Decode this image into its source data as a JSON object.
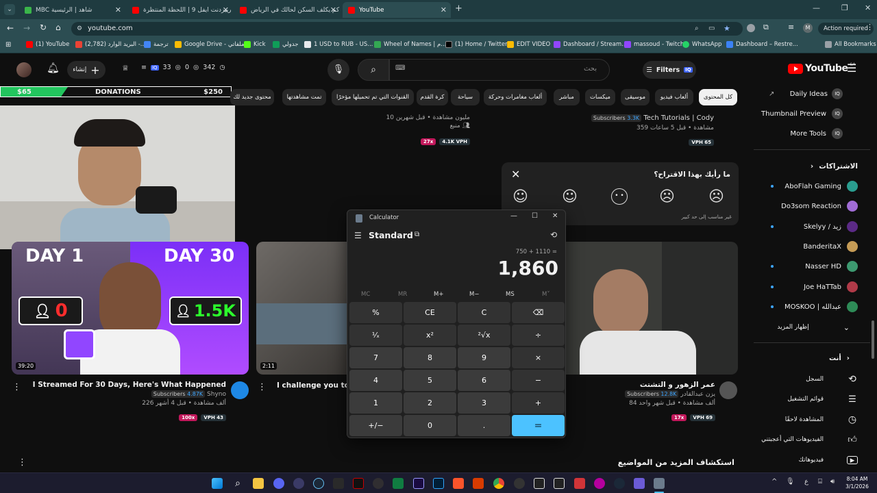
{
  "tabs": [
    {
      "label": "MBC شاهد | الرئيسية",
      "color": "#3ab54a"
    },
    {
      "label": "رييزدنت ايفل 9 | اللحظة المنتظرة",
      "color": "#ff0000"
    },
    {
      "label": "كم يكلف السكن لحالك في الرياض",
      "color": "#ff0000"
    },
    {
      "label": "YouTube",
      "color": "#ff0000"
    }
  ],
  "address": {
    "url": "youtube.com",
    "action_required": "Action required",
    "profile_initial": "M"
  },
  "bookmarks": [
    "(1) YouTube",
    "(2,782) البريد الوارد -...",
    "ترجمة",
    "Google Drive - ملفاتي",
    "Kick",
    "جدولي",
    "1 USD to RUB - US...",
    "Wheel of Names | م...",
    "(1) Home / Twitter",
    "EDIT VIDEO",
    "Dashboard / Stream...",
    "massoud - Twitch",
    "WhatsApp",
    "Dashboard – Restre...",
    "All Bookmarks"
  ],
  "header": {
    "logo": "YouTube",
    "region": "SA",
    "search_placeholder": "بحث",
    "filters": "Filters",
    "create": "إنشاء",
    "stat_a": "342",
    "stat_b": "0",
    "stat_c": "33"
  },
  "donations": {
    "left": "$65",
    "label": "DONATIONS",
    "right": "$250"
  },
  "chips": [
    "كل المحتوى",
    "ألعاب فيديو",
    "موسيقى",
    "ميكسات",
    "مباشر",
    "ألعاب مغامرات وحركة",
    "سياحة",
    "كرة القدم",
    "القنوات التي تم تحميلها مؤخرًا",
    "تمت مشاهدتها",
    "محتوى جديد لك"
  ],
  "sidebar": {
    "tools": [
      "Daily Ideas",
      "Thumbnail Preview",
      "More Tools"
    ],
    "subs_heading": "الاشتراكات",
    "subs": [
      "AboFlah Gaming",
      "Do3som Reaction",
      "Skelyy / زيد",
      "BanderitaX",
      "Nasser HD",
      "Joe HaTTab",
      "MOSKOO | عبدالله"
    ],
    "show_more": "إظهار المزيد",
    "you_heading": "أنت",
    "you": [
      "السجل",
      "قوائم التشغيل",
      "المشاهدة لاحقًا",
      "الفيديوهات التي أعجبتني",
      "فيديوهاتك"
    ]
  },
  "top_videos": [
    {
      "meta1": "10 مليون مشاهدة • قبل شهرين",
      "meta2": "منبع",
      "b1": "27x",
      "b2": "4.1K VPH"
    },
    {
      "channel": "Tech Tutorials | Cody",
      "subs": "3.3K",
      "subs_label": "Subscribers",
      "meta": "359 مشاهدة • قبل 5 ساعات",
      "b1": "VPH 65"
    }
  ],
  "feedback": {
    "question": "ما رأيك بهذا الاقتراح؟",
    "hint": "غير مناسب إلى حد كبير"
  },
  "thumb1": {
    "day1": "DAY 1",
    "day30": "DAY 30",
    "count0": "0",
    "count1": "1.5K",
    "duration": "39:20"
  },
  "video1": {
    "title": "I Streamed For 30 Days, Here's What Happened",
    "channel": "Shyno",
    "subs": "4.87K",
    "subs_label": "Subscribers",
    "meta": "226 ألف مشاهدة • قبل 4 أشهر",
    "b1": "100x",
    "b2": "VPH 43"
  },
  "video2": {
    "title": "I challenge you to c",
    "duration": "2:11"
  },
  "video3": {
    "title": "عمر الزهور و التشتت",
    "channel": "يزن عبدالقادر",
    "subs": "12.8K",
    "subs_label": "Subscribers",
    "meta": "84 ألف مشاهدة • قبل شهر واحد",
    "b1": "17x",
    "b2": "VPH 69"
  },
  "explore": "استكشاف المزيد من المواضيع",
  "calculator": {
    "app_title": "Calculator",
    "mode": "Standard",
    "expression": "750 + 1110 =",
    "result": "1,860",
    "memory": [
      "MC",
      "MR",
      "M+",
      "M−",
      "MS",
      "M˅"
    ],
    "keys": [
      [
        "%",
        "CE",
        "C",
        "⌫"
      ],
      [
        "¹⁄ₓ",
        "x²",
        "²√x",
        "÷"
      ],
      [
        "7",
        "8",
        "9",
        "×"
      ],
      [
        "4",
        "5",
        "6",
        "−"
      ],
      [
        "1",
        "2",
        "3",
        "+"
      ],
      [
        "+/−",
        "0",
        ".",
        "="
      ]
    ]
  },
  "taskbar": {
    "time": "8:04 AM",
    "date": "3/1/2026",
    "lang": "ع"
  }
}
